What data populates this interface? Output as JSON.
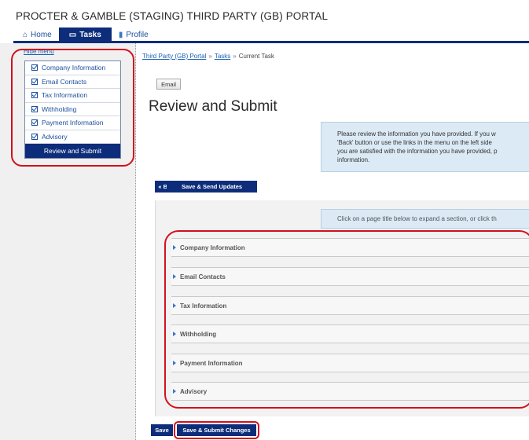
{
  "app": {
    "title": "PROCTER & GAMBLE (STAGING) THIRD PARTY (GB) PORTAL"
  },
  "tabs": [
    {
      "label": "Home",
      "icon": "home-icon"
    },
    {
      "label": "Tasks",
      "icon": "monitor-icon"
    },
    {
      "label": "Profile",
      "icon": "document-icon"
    }
  ],
  "sidebar": {
    "hide_menu": "Hide menu",
    "items": [
      "Company Information",
      "Email Contacts",
      "Tax Information",
      "Withholding",
      "Payment Information",
      "Advisory"
    ],
    "active_item": "Review and Submit"
  },
  "breadcrumb": {
    "home": "Third Party (GB) Portal",
    "tasks": "Tasks",
    "current": "Current Task",
    "separator": "»"
  },
  "main": {
    "email_button": "Email",
    "title": "Review and Submit",
    "info_lines": [
      "Please review the information you have provided. If you w",
      "'Back' button or use the links in the menu on the left side",
      "you are satisfied with the information you have provided, p",
      "information."
    ],
    "back_button": "« Back",
    "save_send_button": "Save & Send Updates",
    "hint": "Click on a page title below to expand a section, or click th",
    "sections": [
      "Company Information",
      "Email Contacts",
      "Tax Information",
      "Withholding",
      "Payment Information",
      "Advisory"
    ],
    "save_button": "Save",
    "submit_button": "Save & Submit Changes"
  }
}
